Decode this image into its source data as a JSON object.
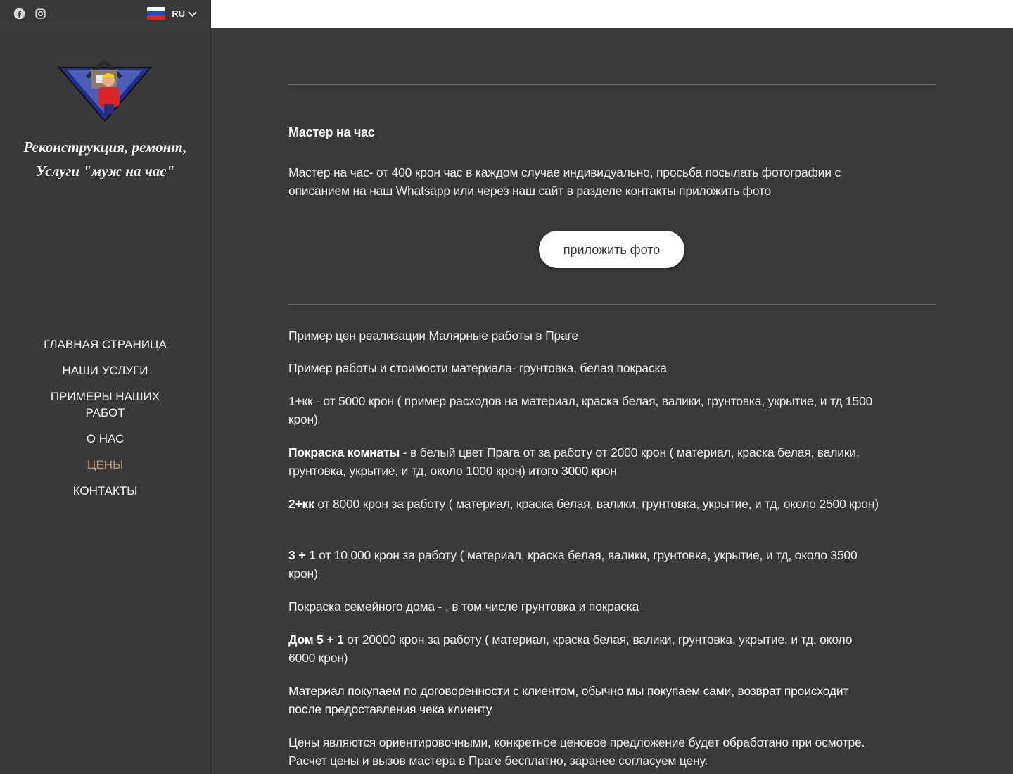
{
  "header": {
    "social": [
      {
        "icon": "facebook-icon"
      },
      {
        "icon": "instagram-icon"
      }
    ],
    "language": {
      "code": "RU",
      "flag": "russia-flag-icon"
    }
  },
  "sidebar": {
    "title_line1": "Реконструкция, ремонт,",
    "title_line2": "Услуги \"муж на час\"",
    "nav": [
      {
        "label": "ГЛАВНАЯ СТРАНИЦА"
      },
      {
        "label": "НАШИ УСЛУГИ"
      },
      {
        "label": "ПРИМЕРЫ НАШИХ РАБОТ"
      },
      {
        "label": "О НАС"
      },
      {
        "label": "ЦЕНЫ",
        "active": true
      },
      {
        "label": "КОНТАКТЫ"
      }
    ]
  },
  "colors": {
    "accent": "#c49a76",
    "background": "#3a3a3a",
    "text": "#f2f2f2"
  },
  "content": {
    "master_heading": "Мастер на час",
    "master_text": "Мастер на час- от 400 крон час в каждом случае индивидуально, просьба посылать фотографии с описанием на наш Whatsapp или через наш сайт в разделе контакты приложить фото",
    "attach_button": "приложить фото",
    "example_title": "Пример цен реализации Малярные работы в Праге",
    "example_subtitle": "Пример работы и стоимости материала-  грунтовка, белая покраска",
    "line_1kk": "1+кк - от 5000 крон ( пример расходов на материал, краска белая, валики, грунтовка, укрытие, и тд 1500 крон)",
    "room_bold": "Покраска комнаты",
    "room_text": " - в белый цвет Прага от за работу от 2000 крон ( материал, краска белая, валики, грунтовка, укрытие, и тд, около 1000 крон) ",
    "room_total": "итого 3000 крон",
    "kk2_bold": "2+кк",
    "kk2_text": " от 8000 крон за работу  ( материал, краска белая, валики, грунтовка, укрытие, и тд, около 2500 крон)",
    "r31_bold": "3 + 1",
    "r31_text": " от  10 000 крон за работу   ( материал, краска белая, валики, грунтовка, укрытие, и тд, около 3500 крон)",
    "house_title": "Покраска семейного дома - , в том числе грунтовка и покраска",
    "house_bold": "Дом 5 + 1",
    "house_text": " от 20000 крон за работу  ( материал, краска белая, валики, грунтовка, укрытие, и тд, около 6000 крон)",
    "material_note": "Материал покупаем по договоренности с клиентом, обычно мы покупаем сами, возврат происходит после предоставления чека клиенту",
    "price_note": "Цены являются ориентировочными, конкретное ценовое предложение будет обработано при осмотре. Расчет цены и вызов мастера в Праге бесплатно, заранее согласуем цену."
  }
}
